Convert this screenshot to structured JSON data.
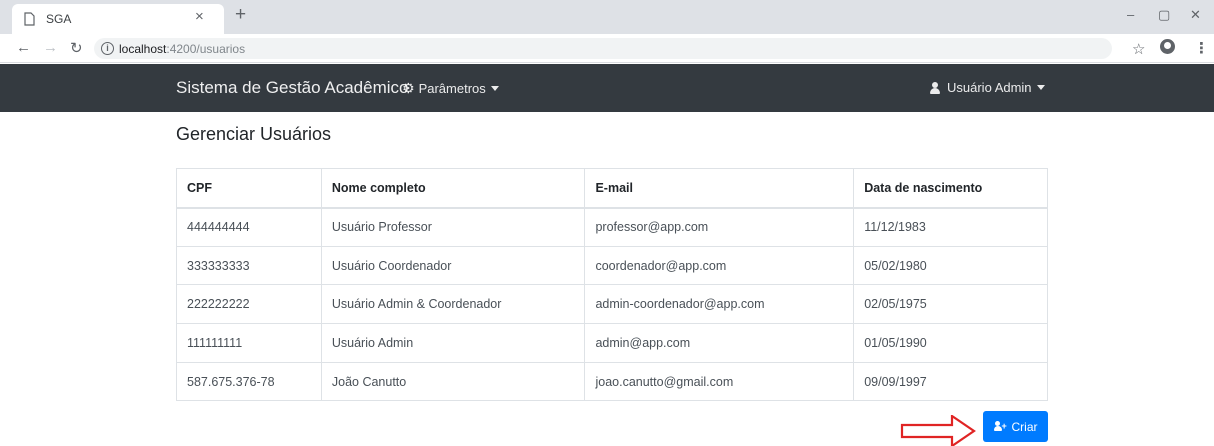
{
  "browser": {
    "tab_title": "SGA",
    "tab_close": "×",
    "new_tab": "+",
    "url_host": "localhost",
    "url_path": ":4200/usuarios",
    "win_minimize": "–",
    "win_maximize": "▢",
    "win_close": "✕"
  },
  "navbar": {
    "brand": "Sistema de Gestão Acadêmico",
    "params_label": "Parâmetros",
    "user_label": "Usuário Admin"
  },
  "page": {
    "title": "Gerenciar Usuários"
  },
  "table": {
    "headers": [
      "CPF",
      "Nome completo",
      "E-mail",
      "Data de nascimento"
    ],
    "rows": [
      [
        "444444444",
        "Usuário Professor",
        "professor@app.com",
        "11/12/1983"
      ],
      [
        "333333333",
        "Usuário Coordenador",
        "coordenador@app.com",
        "05/02/1980"
      ],
      [
        "222222222",
        "Usuário Admin & Coordenador",
        "admin-coordenador@app.com",
        "02/05/1975"
      ],
      [
        "111111111",
        "Usuário Admin",
        "admin@app.com",
        "01/05/1990"
      ],
      [
        "587.675.376-78",
        "João Canutto",
        "joao.canutto@gmail.com",
        "09/09/1997"
      ]
    ]
  },
  "actions": {
    "create_label": "Criar"
  },
  "colors": {
    "navbar_bg": "#343a40",
    "primary": "#007bff",
    "annotation_arrow": "#e02424"
  },
  "icons": [
    "page-icon",
    "close-icon",
    "plus-icon",
    "back-icon",
    "forward-icon",
    "reload-icon",
    "info-icon",
    "star-icon",
    "account-icon",
    "menu-icon",
    "cog-icon",
    "caret-down-icon",
    "user-icon",
    "add-user-icon",
    "arrow-icon"
  ]
}
